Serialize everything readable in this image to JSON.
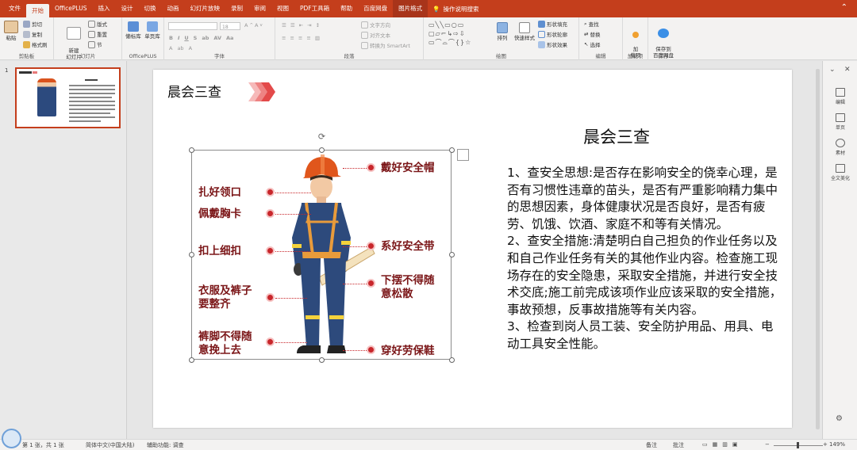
{
  "ribbon_tabs": [
    "文件",
    "开始",
    "OfficePLUS",
    "插入",
    "设计",
    "切换",
    "动画",
    "幻灯片放映",
    "录制",
    "审阅",
    "视图",
    "PDF工具箱",
    "帮助",
    "百度网盘",
    "图片格式"
  ],
  "ribbon_search": "操作说明搜索",
  "ribbon": {
    "clipboard": {
      "paste": "粘贴",
      "cut": "剪切",
      "copy": "复制",
      "format_painter": "格式刷",
      "label": "剪贴板"
    },
    "slides": {
      "new_slide": "新建\n幻灯片",
      "layout": "版式",
      "reset": "重置",
      "section": "节",
      "label": "幻灯片"
    },
    "officeplus": {
      "template": "懒标库",
      "pages": "单页库",
      "label": "OfficePLUS"
    },
    "font": {
      "size": "18",
      "label": "字体"
    },
    "paragraph": {
      "text_direction": "文字方向",
      "align_text": "对齐文本",
      "smartart": "转换为 SmartArt",
      "label": "段落"
    },
    "drawing": {
      "arrange": "排列",
      "quick_styles": "快速样式",
      "shape_fill": "形状填充",
      "shape_outline": "形状轮廓",
      "shape_effects": "形状效果",
      "label": "绘图"
    },
    "editing": {
      "find": "查找",
      "replace": "替换",
      "select": "选择",
      "label": "编辑"
    },
    "addins": {
      "add": "加\n载项",
      "label": "加载项"
    },
    "save": {
      "save_to_baidu": "保存到\n百度网盘",
      "label": "保存"
    }
  },
  "thumbnail": {
    "number": "1"
  },
  "slide": {
    "title": "晨会三查",
    "body_title": "晨会三查",
    "paragraphs": [
      "1、查安全思想:是否存在影响安全的侥幸心理，是否有习惯性违章的苗头，是否有严重影响精力集中的思想因素，身体健康状况是否良好，是否有疲劳、饥饿、饮酒、家庭不和等有关情况。",
      "2、查安全措施:清楚明白自己担负的作业任务以及和自己作业任务有关的其他作业内容。检查施工现场存在的安全隐患，采取安全措施，并进行安全技术交底;施工前完成该项作业应该采取的安全措施，事故预想，反事故措施等有关内容。",
      "3、检查到岗人员工装、安全防护用品、用具、电动工具安全性能。"
    ],
    "labels": {
      "helmet": "戴好安全帽",
      "collar": "扎好领口",
      "badge": "佩戴胸卡",
      "buttons": "扣上细扣",
      "harness": "系好安全带",
      "clothes": "衣服及裤子\n要整齐",
      "hem": "下摆不得随\n意松散",
      "cuffs": "裤脚不得随\n意挽上去",
      "shoes": "穿好劳保鞋"
    }
  },
  "right_panel": [
    {
      "label": "编辑",
      "icon": "edit-icon"
    },
    {
      "label": "单页",
      "icon": "single-page-icon"
    },
    {
      "label": "素材",
      "icon": "clock-icon"
    },
    {
      "label": "全文美化",
      "icon": "shirt-icon"
    }
  ],
  "status": {
    "slide_count": "第 1 张，共 1 张",
    "language": "简体中文(中国大陆)",
    "accessibility": "辅助功能: 调查",
    "notes": "备注",
    "comments": "批注",
    "zoom": "149%"
  },
  "colors": {
    "accent": "#c43e1c",
    "label_text": "#7b1618",
    "dot": "#c8262b"
  }
}
